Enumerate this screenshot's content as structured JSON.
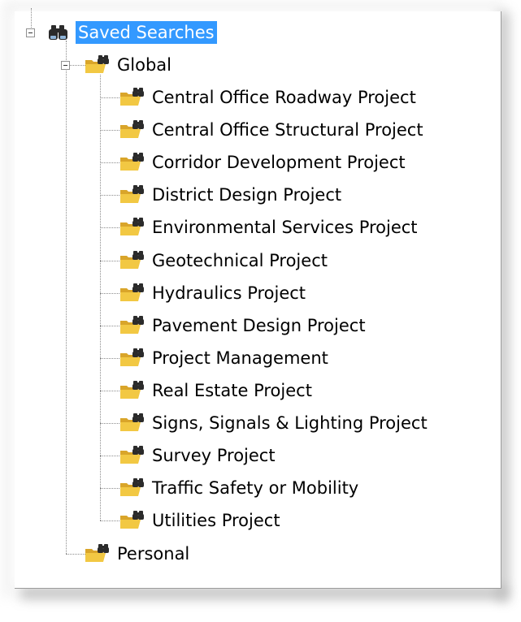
{
  "tree": {
    "root": {
      "label": "Saved Searches",
      "icon": "binoculars-icon",
      "expanded": true,
      "selected": true
    },
    "global": {
      "label": "Global",
      "icon": "folder-search-icon",
      "expanded": true
    },
    "global_items": [
      {
        "label": "Central Office Roadway Project",
        "icon": "folder-search-icon"
      },
      {
        "label": "Central Office Structural Project",
        "icon": "folder-search-icon"
      },
      {
        "label": "Corridor Development Project",
        "icon": "folder-search-icon"
      },
      {
        "label": "District Design Project",
        "icon": "folder-search-icon"
      },
      {
        "label": "Environmental Services Project",
        "icon": "folder-search-icon"
      },
      {
        "label": "Geotechnical Project",
        "icon": "folder-search-icon"
      },
      {
        "label": "Hydraulics Project",
        "icon": "folder-search-icon"
      },
      {
        "label": "Pavement Design Project",
        "icon": "folder-search-icon"
      },
      {
        "label": "Project Management",
        "icon": "folder-search-icon"
      },
      {
        "label": "Real Estate Project",
        "icon": "folder-search-icon"
      },
      {
        "label": "Signs, Signals & Lighting Project",
        "icon": "folder-search-icon"
      },
      {
        "label": "Survey Project",
        "icon": "folder-search-icon"
      },
      {
        "label": "Traffic Safety or Mobility",
        "icon": "folder-search-icon"
      },
      {
        "label": "Utilities Project",
        "icon": "folder-search-icon"
      }
    ],
    "personal": {
      "label": "Personal",
      "icon": "folder-search-icon"
    }
  },
  "colors": {
    "selection": "#3399ff",
    "folder": "#f2c843",
    "binoculars": "#2b2b2b"
  }
}
